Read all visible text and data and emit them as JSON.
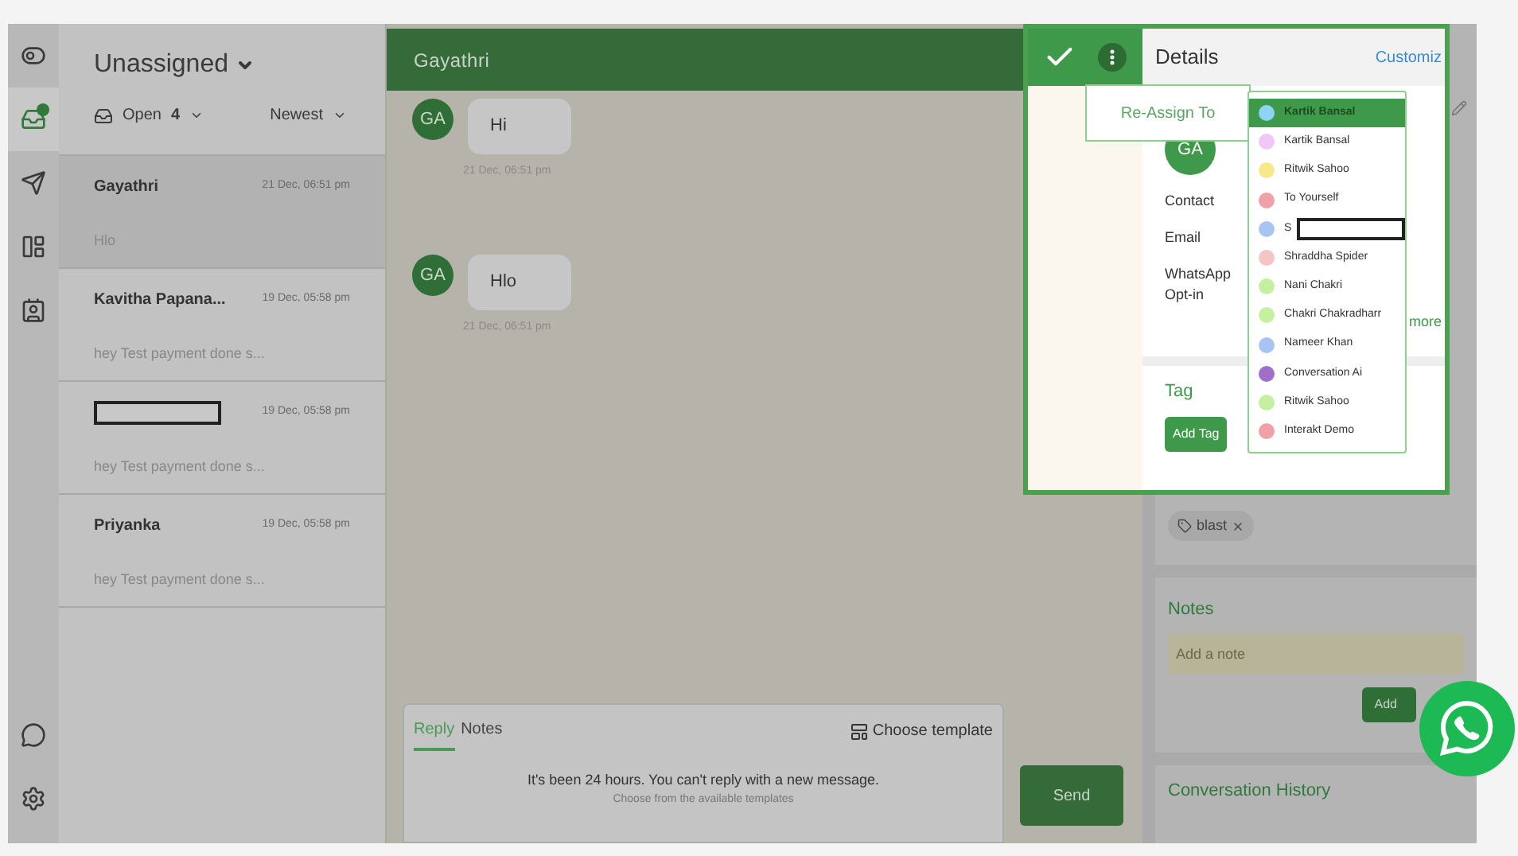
{
  "rail": {
    "top": [
      {
        "kind": "toggle",
        "selected": false
      },
      {
        "kind": "inbox",
        "selected": true
      },
      {
        "kind": "send",
        "selected": false
      },
      {
        "kind": "layout",
        "selected": false
      },
      {
        "kind": "contacts",
        "selected": false
      }
    ],
    "bottom": [
      {
        "kind": "chat"
      },
      {
        "kind": "settings"
      }
    ]
  },
  "inbox": {
    "title": "Unassigned",
    "status": "Open",
    "count": "4",
    "sort": "Newest"
  },
  "conversations": [
    {
      "name": "Gayathri",
      "time": "21 Dec, 06:51 pm",
      "preview": "Hlo",
      "selected": true,
      "redacted": false
    },
    {
      "name": "Kavitha Papana...",
      "time": "19 Dec, 05:58 pm",
      "preview": "hey Test payment done s...",
      "selected": false,
      "redacted": false
    },
    {
      "time": "19 Dec, 05:58 pm",
      "preview": "hey Test payment done s...",
      "selected": false,
      "redacted": true
    },
    {
      "name": "Priyanka",
      "time": "19 Dec, 05:58 pm",
      "preview": "hey Test payment done s...",
      "selected": false,
      "redacted": false
    }
  ],
  "chat": {
    "title": "Gayathri",
    "messages": [
      {
        "avatar": "GA",
        "text": "Hi",
        "time": "21 Dec, 06:51 pm"
      },
      {
        "avatar": "GA",
        "text": "Hlo",
        "time": "21 Dec, 06:51 pm"
      }
    ],
    "composer": {
      "tabs": [
        {
          "label": "Reply",
          "selected": true
        },
        {
          "label": "Notes",
          "selected": false
        }
      ],
      "template_button": "Choose template",
      "notice": "It's been 24 hours. You can't reply with a new message.",
      "hint": "Choose from the available templates",
      "send": "Send"
    }
  },
  "reassign": {
    "label": "Re-Assign To",
    "agents": [
      {
        "name": "Kartik Bansal",
        "color": "#8fd3f5",
        "selected": true
      },
      {
        "name": "Kartik Bansal",
        "color": "#f0c8f5",
        "selected": false
      },
      {
        "name": "Ritwik Sahoo",
        "color": "#f7e98a",
        "selected": false
      },
      {
        "name": "To Yourself",
        "color": "#f0a0a8",
        "selected": false
      },
      {
        "name": "S",
        "color": "#a8c4f5",
        "selected": false,
        "redacted": true
      },
      {
        "name": "Shraddha Spider",
        "color": "#f5c4c4",
        "selected": false
      },
      {
        "name": "Nani Chakri",
        "color": "#c4f0a0",
        "selected": false
      },
      {
        "name": "Chakri Chakradharr",
        "color": "#c4f0a0",
        "selected": false
      },
      {
        "name": "Nameer Khan",
        "color": "#a8c4f5",
        "selected": false
      },
      {
        "name": "Conversation Ai",
        "color": "#a070c8",
        "selected": false
      },
      {
        "name": "Ritwik Sahoo",
        "color": "#c4f0a0",
        "selected": false
      },
      {
        "name": "Interakt Demo",
        "color": "#f0a0a8",
        "selected": false
      }
    ]
  },
  "details": {
    "title": "Details",
    "customize": "Customiz",
    "avatar": "GA",
    "fields": [
      "Contact",
      "Email",
      "WhatsApp Opt-in"
    ],
    "more": "more",
    "tag": {
      "title": "Tag",
      "button": "Add Tag",
      "tags": [
        "blast"
      ]
    },
    "notes": {
      "title": "Notes",
      "placeholder": "Add a note",
      "button": "Add"
    },
    "history": {
      "title": "Conversation History"
    }
  }
}
